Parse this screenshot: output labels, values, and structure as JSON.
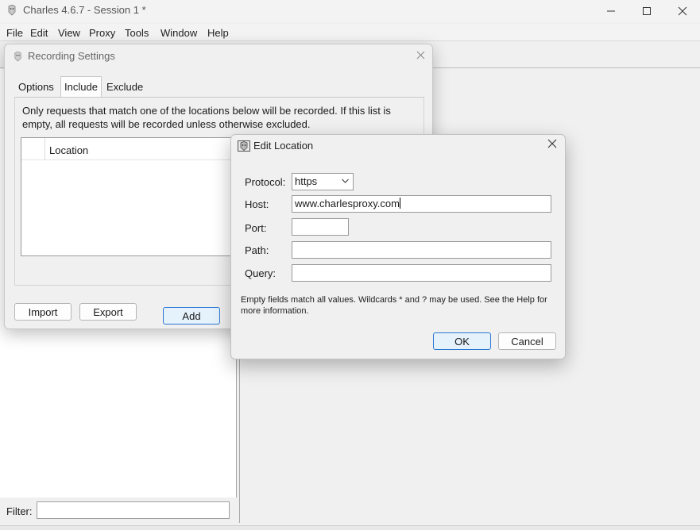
{
  "window": {
    "title": "Charles 4.6.7 - Session 1 *",
    "controls": {
      "minimize": "—",
      "maximize": "☐",
      "close": "✕"
    }
  },
  "menu": [
    "File",
    "Edit",
    "View",
    "Proxy",
    "Tools",
    "Window",
    "Help"
  ],
  "filter": {
    "label": "Filter:",
    "value": ""
  },
  "recording_settings": {
    "title": "Recording Settings",
    "tabs": [
      "Options",
      "Include",
      "Exclude"
    ],
    "active_tab": "Include",
    "description": "Only requests that match one of the locations below will be recorded. If this list is empty, all requests will be recorded unless otherwise excluded.",
    "table": {
      "column": "Location",
      "rows": []
    },
    "buttons": {
      "add": "Add",
      "import": "Import",
      "export": "Export"
    }
  },
  "edit_location": {
    "title": "Edit Location",
    "fields": {
      "protocol": {
        "label": "Protocol:",
        "value": "https"
      },
      "host": {
        "label": "Host:",
        "value": "www.charlesproxy.com"
      },
      "port": {
        "label": "Port:",
        "value": ""
      },
      "path": {
        "label": "Path:",
        "value": ""
      },
      "query": {
        "label": "Query:",
        "value": ""
      }
    },
    "hint": "Empty fields match all values. Wildcards * and ? may be used. See the Help for more information.",
    "buttons": {
      "ok": "OK",
      "cancel": "Cancel"
    }
  },
  "colors": {
    "accent": "#2b78d0",
    "button_focus_bg": "#e5f1fb"
  }
}
